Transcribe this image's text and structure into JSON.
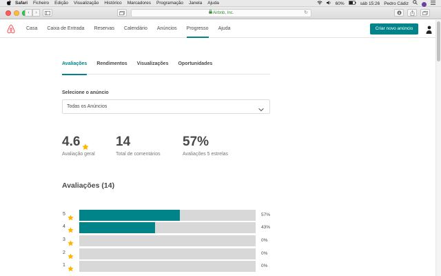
{
  "menubar": {
    "apple": "",
    "app_name": "Safari",
    "menus": [
      "Ficheiro",
      "Edição",
      "Visualização",
      "Histórico",
      "Marcadores",
      "Programação",
      "Janela",
      "Ajuda"
    ],
    "battery": "60%",
    "clock": "sáb 15:26",
    "user": "Pedro Cádiz"
  },
  "browser": {
    "url": "Airbnb, Inc.",
    "colors": {
      "secure": "#3a8a3a"
    }
  },
  "header": {
    "nav": [
      "Casa",
      "Caixa de Entrada",
      "Reservas",
      "Calendário",
      "Anúncios",
      "Progresso",
      "Ajuda"
    ],
    "active_nav": "Progresso",
    "cta_label": "Criar novo anúncio",
    "colors": {
      "brand": "#FF5A5F",
      "accent": "#008489"
    }
  },
  "tabs": {
    "items": [
      "Avaliações",
      "Rendimentos",
      "Visualizações",
      "Oportunidades"
    ],
    "active": "Avaliações"
  },
  "listing_select": {
    "label": "Selecione o anúncio",
    "value": "Todas os Anúncios"
  },
  "stats": {
    "overall": {
      "value": "4.6",
      "label": "Avaliação geral"
    },
    "total": {
      "value": "14",
      "label": "Total de comentários"
    },
    "five_star": {
      "value": "57%",
      "label": "Avaliações 5 estrelas"
    }
  },
  "reviews": {
    "title": "Avaliações (14)",
    "breakdown": [
      {
        "stars": "5",
        "percent": 57,
        "percent_label": "57%"
      },
      {
        "stars": "4",
        "percent": 43,
        "percent_label": "43%"
      },
      {
        "stars": "3",
        "percent": 0,
        "percent_label": "0%"
      },
      {
        "stars": "2",
        "percent": 0,
        "percent_label": "0%"
      },
      {
        "stars": "1",
        "percent": 0,
        "percent_label": "0%"
      }
    ],
    "colors": {
      "bar_fill": "#008489",
      "bar_track": "#d8d8d8",
      "star": "#FFB400"
    }
  }
}
